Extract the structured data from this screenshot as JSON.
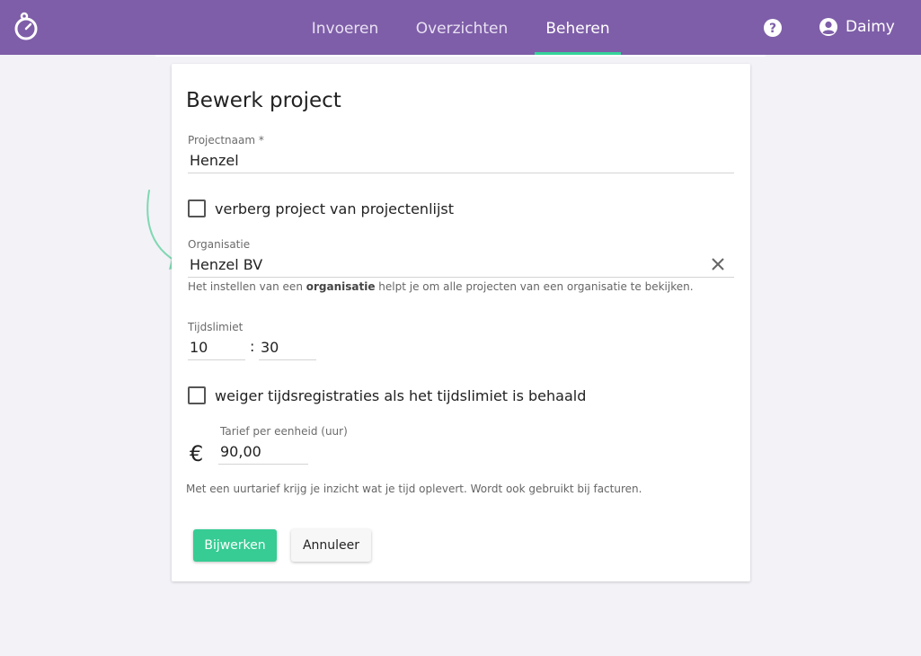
{
  "header": {
    "tabs": [
      {
        "label": "Invoeren"
      },
      {
        "label": "Overzichten"
      },
      {
        "label": "Beheren"
      }
    ],
    "active_tab": "Beheren",
    "user_name": "Daimy",
    "icons": {
      "logo": "stopwatch-icon",
      "help": "help-icon",
      "user": "account-circle-icon"
    }
  },
  "form": {
    "title": "Bewerk project",
    "project_name": {
      "label": "Projectnaam *",
      "value": "Henzel"
    },
    "hide_project": {
      "label": "verberg project van projectenlijst",
      "checked": false
    },
    "organisation": {
      "label": "Organisatie",
      "value": "Henzel BV",
      "hint_before": "Het instellen van een ",
      "hint_bold": "organisatie",
      "hint_after": " helpt je om alle projecten van een organisatie te bekijken."
    },
    "time_limit": {
      "label": "Tijdslimiet",
      "hours": "10",
      "separator": ":",
      "minutes": "30"
    },
    "refuse_registrations": {
      "label": "weiger tijdsregistraties als het tijdslimiet is behaald",
      "checked": false
    },
    "rate": {
      "currency_symbol": "€",
      "label": "Tarief per eenheid (uur)",
      "value": "90,00",
      "hint": "Met een uurtarief krijg je inzicht wat je tijd oplevert. Wordt ook gebruikt bij facturen."
    },
    "buttons": {
      "submit": "Bijwerken",
      "cancel": "Annuleer"
    }
  },
  "colors": {
    "header": "#7e5ea8",
    "accent": "#36cc93",
    "background": "#f3f2f7"
  }
}
